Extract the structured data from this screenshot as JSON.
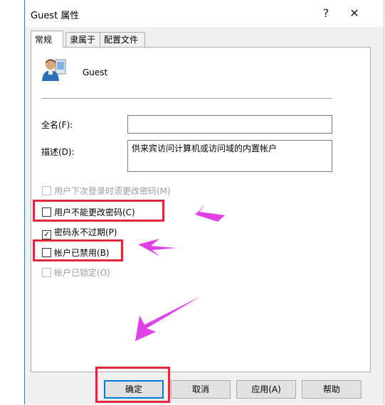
{
  "window": {
    "title": "Guest 属性",
    "help_glyph": "?",
    "close_glyph": "✕"
  },
  "tabs": [
    {
      "label": "常规",
      "active": true
    },
    {
      "label": "隶属于",
      "active": false
    },
    {
      "label": "配置文件",
      "active": false
    }
  ],
  "general": {
    "username": "Guest",
    "fullname_label": "全名(F):",
    "fullname_value": "",
    "description_label": "描述(D):",
    "description_value": "供来宾访问计算机或访问域的内置帐户"
  },
  "checkboxes": [
    {
      "label": "用户下次登录时须更改密码(M)",
      "checked": false,
      "enabled": false,
      "mark": ""
    },
    {
      "label": "用户不能更改密码(C)",
      "checked": false,
      "enabled": true,
      "mark": ""
    },
    {
      "label": "密码永不过期(P)",
      "checked": true,
      "enabled": true,
      "mark": "✓"
    },
    {
      "label": "帐户已禁用(B)",
      "checked": false,
      "enabled": true,
      "mark": ""
    },
    {
      "label": "帐户已锁定(O)",
      "checked": false,
      "enabled": false,
      "mark": ""
    }
  ],
  "buttons": {
    "ok": "确定",
    "cancel": "取消",
    "apply": "应用(A)",
    "help": "帮助"
  },
  "colors": {
    "highlight": "#e0283c",
    "arrow": "#e040e8",
    "default_button_border": "#0078d7"
  }
}
